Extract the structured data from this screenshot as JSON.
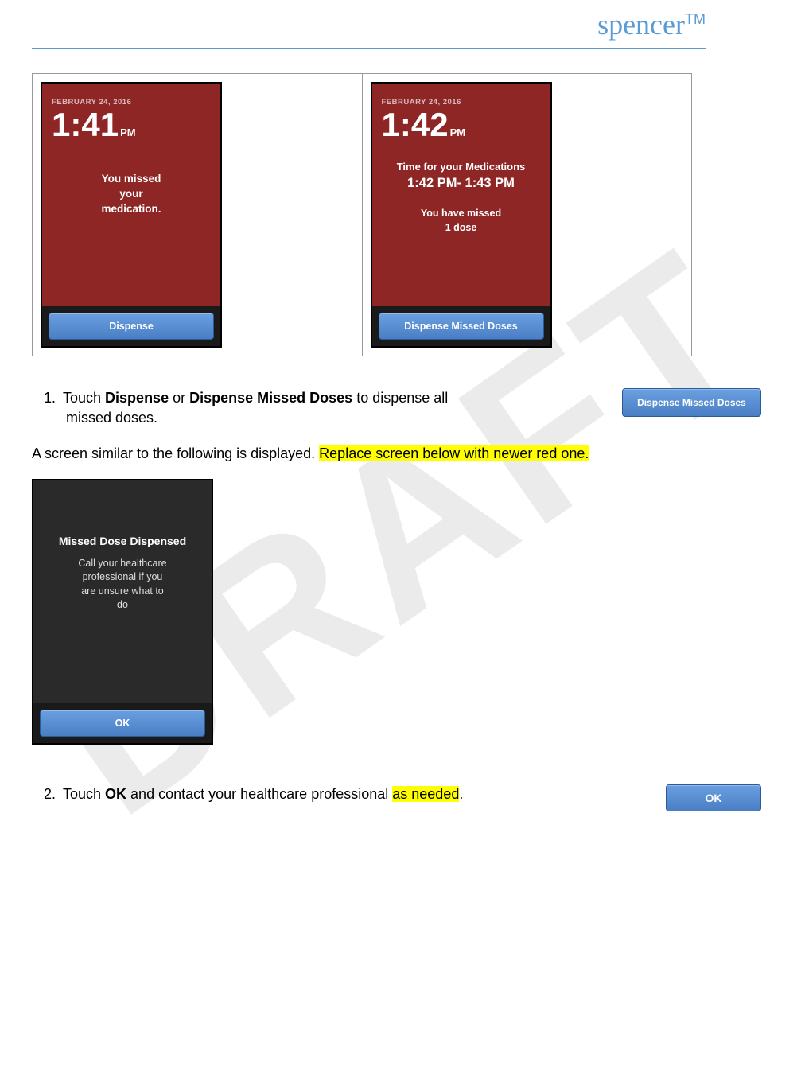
{
  "brand": {
    "name": "spencer",
    "tm": "TM"
  },
  "watermark": "DRAFT",
  "screens": {
    "left": {
      "date": "FEBRUARY 24, 2016",
      "time": "1:41",
      "ampm": "PM",
      "msg1": "You missed",
      "msg2": "your",
      "msg3": "medication.",
      "button": "Dispense"
    },
    "right": {
      "date": "FEBRUARY 24, 2016",
      "time": "1:42",
      "ampm": "PM",
      "title": "Time for your Medications",
      "range": "1:42 PM- 1:43 PM",
      "sub1": "You have missed",
      "sub2": "1 dose",
      "button": "Dispense Missed Doses"
    },
    "dispensed": {
      "title": "Missed Dose Dispensed",
      "body1": "Call your healthcare",
      "body2": "professional if you",
      "body3": "are unsure what to",
      "body4": "do",
      "button": "OK"
    }
  },
  "instructions": {
    "step1_num": "1.",
    "step1_a": "Touch ",
    "step1_b": "Dispense",
    "step1_c": " or ",
    "step1_d": "Dispense Missed Doses",
    "step1_e": " to dispense all",
    "step1_f": "missed doses.",
    "step1_button": "Dispense Missed Doses",
    "para1_a": "A screen similar to the following is displayed. ",
    "para1_hl": "Replace screen below with newer red one.",
    "step2_num": "2.",
    "step2_a": "Touch ",
    "step2_b": "OK",
    "step2_c": " and contact your healthcare professional ",
    "step2_hl": "as needed",
    "step2_d": ".",
    "step2_button": "OK"
  }
}
